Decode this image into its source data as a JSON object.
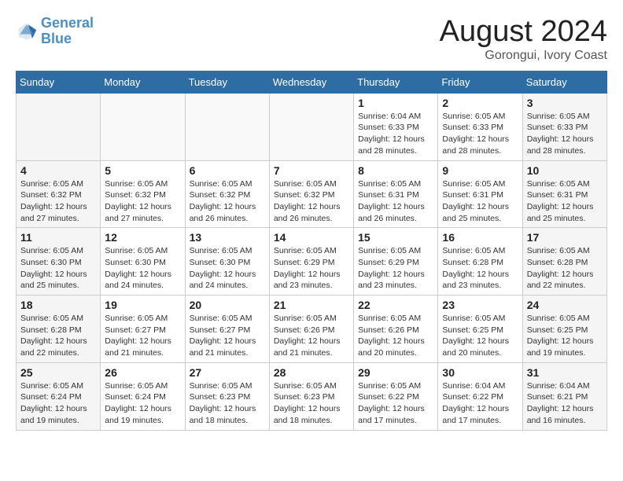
{
  "header": {
    "logo_line1": "General",
    "logo_line2": "Blue",
    "month": "August 2024",
    "location": "Gorongui, Ivory Coast"
  },
  "days_of_week": [
    "Sunday",
    "Monday",
    "Tuesday",
    "Wednesday",
    "Thursday",
    "Friday",
    "Saturday"
  ],
  "weeks": [
    [
      {
        "day": "",
        "info": ""
      },
      {
        "day": "",
        "info": ""
      },
      {
        "day": "",
        "info": ""
      },
      {
        "day": "",
        "info": ""
      },
      {
        "day": "1",
        "info": "Sunrise: 6:04 AM\nSunset: 6:33 PM\nDaylight: 12 hours\nand 28 minutes."
      },
      {
        "day": "2",
        "info": "Sunrise: 6:05 AM\nSunset: 6:33 PM\nDaylight: 12 hours\nand 28 minutes."
      },
      {
        "day": "3",
        "info": "Sunrise: 6:05 AM\nSunset: 6:33 PM\nDaylight: 12 hours\nand 28 minutes."
      }
    ],
    [
      {
        "day": "4",
        "info": "Sunrise: 6:05 AM\nSunset: 6:32 PM\nDaylight: 12 hours\nand 27 minutes."
      },
      {
        "day": "5",
        "info": "Sunrise: 6:05 AM\nSunset: 6:32 PM\nDaylight: 12 hours\nand 27 minutes."
      },
      {
        "day": "6",
        "info": "Sunrise: 6:05 AM\nSunset: 6:32 PM\nDaylight: 12 hours\nand 26 minutes."
      },
      {
        "day": "7",
        "info": "Sunrise: 6:05 AM\nSunset: 6:32 PM\nDaylight: 12 hours\nand 26 minutes."
      },
      {
        "day": "8",
        "info": "Sunrise: 6:05 AM\nSunset: 6:31 PM\nDaylight: 12 hours\nand 26 minutes."
      },
      {
        "day": "9",
        "info": "Sunrise: 6:05 AM\nSunset: 6:31 PM\nDaylight: 12 hours\nand 25 minutes."
      },
      {
        "day": "10",
        "info": "Sunrise: 6:05 AM\nSunset: 6:31 PM\nDaylight: 12 hours\nand 25 minutes."
      }
    ],
    [
      {
        "day": "11",
        "info": "Sunrise: 6:05 AM\nSunset: 6:30 PM\nDaylight: 12 hours\nand 25 minutes."
      },
      {
        "day": "12",
        "info": "Sunrise: 6:05 AM\nSunset: 6:30 PM\nDaylight: 12 hours\nand 24 minutes."
      },
      {
        "day": "13",
        "info": "Sunrise: 6:05 AM\nSunset: 6:30 PM\nDaylight: 12 hours\nand 24 minutes."
      },
      {
        "day": "14",
        "info": "Sunrise: 6:05 AM\nSunset: 6:29 PM\nDaylight: 12 hours\nand 23 minutes."
      },
      {
        "day": "15",
        "info": "Sunrise: 6:05 AM\nSunset: 6:29 PM\nDaylight: 12 hours\nand 23 minutes."
      },
      {
        "day": "16",
        "info": "Sunrise: 6:05 AM\nSunset: 6:28 PM\nDaylight: 12 hours\nand 23 minutes."
      },
      {
        "day": "17",
        "info": "Sunrise: 6:05 AM\nSunset: 6:28 PM\nDaylight: 12 hours\nand 22 minutes."
      }
    ],
    [
      {
        "day": "18",
        "info": "Sunrise: 6:05 AM\nSunset: 6:28 PM\nDaylight: 12 hours\nand 22 minutes."
      },
      {
        "day": "19",
        "info": "Sunrise: 6:05 AM\nSunset: 6:27 PM\nDaylight: 12 hours\nand 21 minutes."
      },
      {
        "day": "20",
        "info": "Sunrise: 6:05 AM\nSunset: 6:27 PM\nDaylight: 12 hours\nand 21 minutes."
      },
      {
        "day": "21",
        "info": "Sunrise: 6:05 AM\nSunset: 6:26 PM\nDaylight: 12 hours\nand 21 minutes."
      },
      {
        "day": "22",
        "info": "Sunrise: 6:05 AM\nSunset: 6:26 PM\nDaylight: 12 hours\nand 20 minutes."
      },
      {
        "day": "23",
        "info": "Sunrise: 6:05 AM\nSunset: 6:25 PM\nDaylight: 12 hours\nand 20 minutes."
      },
      {
        "day": "24",
        "info": "Sunrise: 6:05 AM\nSunset: 6:25 PM\nDaylight: 12 hours\nand 19 minutes."
      }
    ],
    [
      {
        "day": "25",
        "info": "Sunrise: 6:05 AM\nSunset: 6:24 PM\nDaylight: 12 hours\nand 19 minutes."
      },
      {
        "day": "26",
        "info": "Sunrise: 6:05 AM\nSunset: 6:24 PM\nDaylight: 12 hours\nand 19 minutes."
      },
      {
        "day": "27",
        "info": "Sunrise: 6:05 AM\nSunset: 6:23 PM\nDaylight: 12 hours\nand 18 minutes."
      },
      {
        "day": "28",
        "info": "Sunrise: 6:05 AM\nSunset: 6:23 PM\nDaylight: 12 hours\nand 18 minutes."
      },
      {
        "day": "29",
        "info": "Sunrise: 6:05 AM\nSunset: 6:22 PM\nDaylight: 12 hours\nand 17 minutes."
      },
      {
        "day": "30",
        "info": "Sunrise: 6:04 AM\nSunset: 6:22 PM\nDaylight: 12 hours\nand 17 minutes."
      },
      {
        "day": "31",
        "info": "Sunrise: 6:04 AM\nSunset: 6:21 PM\nDaylight: 12 hours\nand 16 minutes."
      }
    ]
  ]
}
